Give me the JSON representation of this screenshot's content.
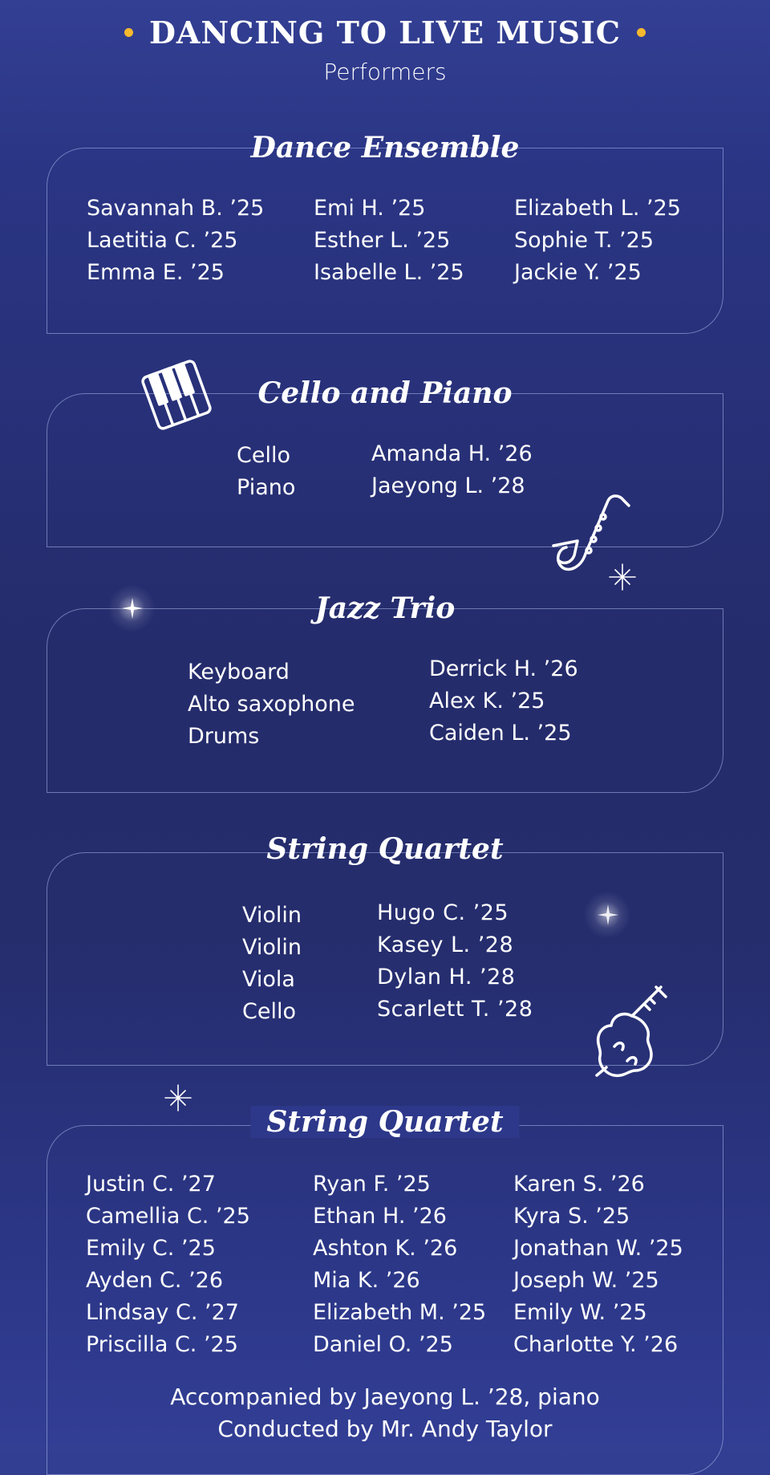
{
  "header": {
    "title": "DANCING TO LIVE MUSIC",
    "subtitle": "Performers"
  },
  "sections": [
    {
      "title": "Dance Ensemble",
      "columns": [
        [
          "Savannah B. ’25",
          "Laetitia C. ’25",
          "Emma E. ’25"
        ],
        [
          "Emi H. ’25",
          "Esther L. ’25",
          "Isabelle L. ’25"
        ],
        [
          "Elizabeth L. ’25",
          "Sophie T. ’25",
          "Jackie Y. ’25"
        ]
      ]
    },
    {
      "title": "Cello and Piano",
      "instruments": [
        "Cello",
        "Piano"
      ],
      "performers": [
        "Amanda H. ’26",
        "Jaeyong L. ’28"
      ]
    },
    {
      "title": "Jazz Trio",
      "instruments": [
        "Keyboard",
        "Alto saxophone",
        "Drums"
      ],
      "performers": [
        "Derrick H. ’26",
        "Alex K. ’25",
        "Caiden L. ’25"
      ]
    },
    {
      "title": "String Quartet",
      "instruments": [
        "Violin",
        "Violin",
        "Viola",
        "Cello"
      ],
      "performers": [
        "Hugo C. ’25",
        "Kasey L. ’28",
        "Dylan H. ’28",
        "Scarlett T. ’28"
      ]
    },
    {
      "title": "String Quartet",
      "columns": [
        [
          "Justin C. ’27",
          "Camellia C. ’25",
          "Emily C. ’25",
          "Ayden C. ’26",
          "Lindsay C. ’27",
          "Priscilla C. ’25"
        ],
        [
          "Ryan F. ’25",
          "Ethan H. ’26",
          "Ashton K. ’26",
          "Mia K. ’26",
          "Elizabeth M. ’25",
          "Daniel O. ’25"
        ],
        [
          "Karen S. ’26",
          "Kyra S. ’25",
          "Jonathan W. ’25",
          "Joseph W. ’25",
          "Emily W. ’25",
          "Charlotte Y. ’26"
        ]
      ],
      "footer": [
        "Accompanied by Jaeyong L. ’28, piano",
        "Conducted by Mr. Andy Taylor"
      ]
    }
  ],
  "colors": {
    "accent_dot": "#f5b82e",
    "background": "#2a3482",
    "frame": "#aab9eb"
  },
  "icons": [
    "piano-icon",
    "saxophone-icon",
    "violin-icon",
    "sparkle-icon"
  ]
}
